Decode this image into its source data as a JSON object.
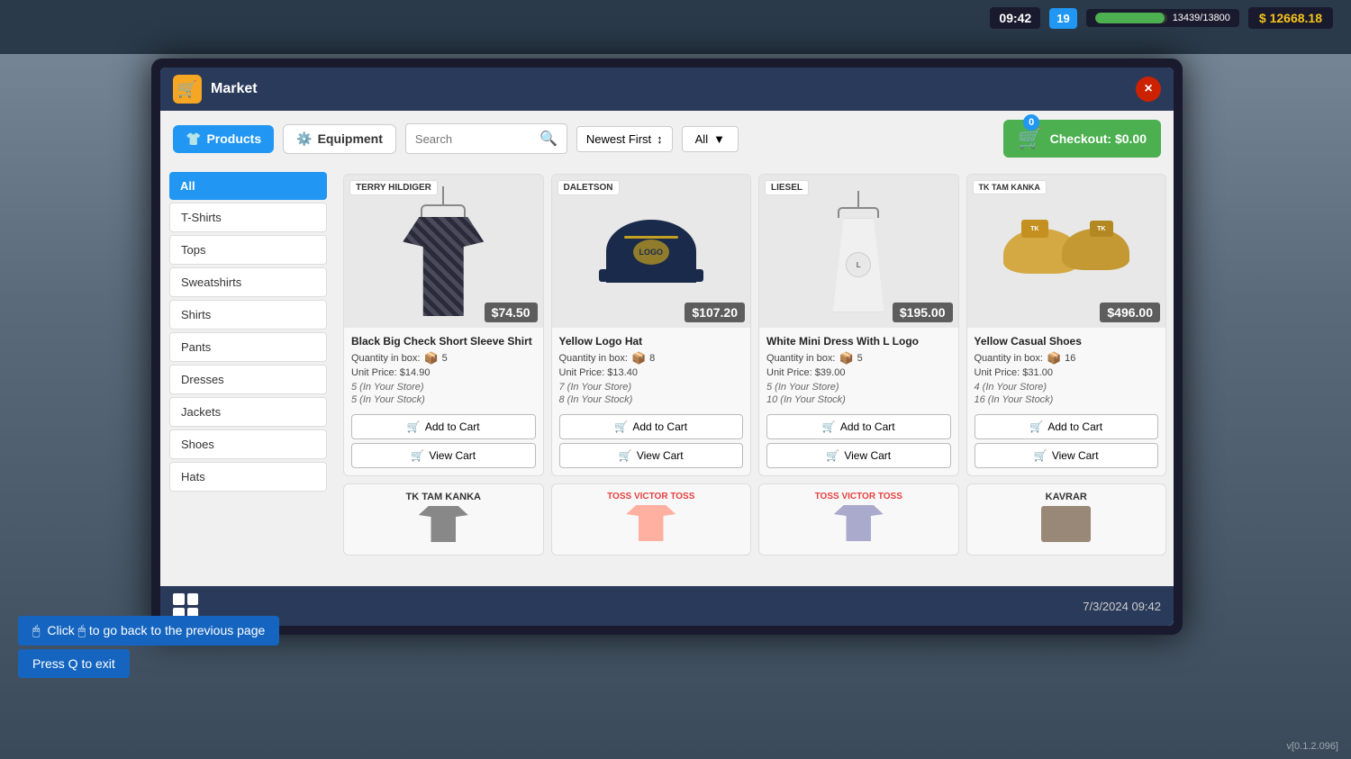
{
  "hud": {
    "time": "09:42",
    "level": "19",
    "xp_current": "13439",
    "xp_max": "13800",
    "xp_display": "13439/13800",
    "money": "$ 12668.18",
    "xp_percent": 97
  },
  "window": {
    "title": "Market",
    "close_label": "×"
  },
  "nav": {
    "products_tab": "Products",
    "equipment_tab": "Equipment",
    "search_placeholder": "Search",
    "sort_label": "Newest First",
    "filter_label": "All",
    "checkout_label": "Checkout: $0.00",
    "cart_count": "0"
  },
  "sidebar": {
    "items": [
      {
        "label": "All",
        "active": true
      },
      {
        "label": "T-Shirts",
        "active": false
      },
      {
        "label": "Tops",
        "active": false
      },
      {
        "label": "Sweatshirts",
        "active": false
      },
      {
        "label": "Shirts",
        "active": false
      },
      {
        "label": "Pants",
        "active": false
      },
      {
        "label": "Dresses",
        "active": false
      },
      {
        "label": "Jackets",
        "active": false
      },
      {
        "label": "Shoes",
        "active": false
      },
      {
        "label": "Hats",
        "active": false
      }
    ]
  },
  "products": [
    {
      "id": 1,
      "brand": "TERRY HILDIGER",
      "name": "Black Big Check Short Sleeve Shirt",
      "price": "$74.50",
      "qty_label": "Quantity in box:",
      "qty": "5",
      "unit_price": "Unit Price: $14.90",
      "store_qty": "5 (In Your Store)",
      "stock_qty": "5 (In Your Stock)",
      "type": "shirt"
    },
    {
      "id": 2,
      "brand": "DALETSON",
      "name": "Yellow Logo Hat",
      "price": "$107.20",
      "qty_label": "Quantity in box:",
      "qty": "8",
      "unit_price": "Unit Price: $13.40",
      "store_qty": "7 (In Your Store)",
      "stock_qty": "8 (In Your Stock)",
      "type": "hat"
    },
    {
      "id": 3,
      "brand": "LIESEL",
      "name": "White Mini Dress With L Logo",
      "price": "$195.00",
      "qty_label": "Quantity in box:",
      "qty": "5",
      "unit_price": "Unit Price: $39.00",
      "store_qty": "5 (In Your Store)",
      "stock_qty": "10 (In Your Stock)",
      "type": "dress"
    },
    {
      "id": 4,
      "brand": "TK TAM KANKA",
      "name": "Yellow Casual Shoes",
      "price": "$496.00",
      "qty_label": "Quantity in box:",
      "qty": "16",
      "unit_price": "Unit Price: $31.00",
      "store_qty": "4 (In Your Store)",
      "stock_qty": "16 (In Your Stock)",
      "type": "shoes"
    }
  ],
  "bottom_row_brands": [
    "TK TAM KANKA",
    "TOSS VICTOR TOSS",
    "TOSS VICTOR TOSS",
    "KAVRAR"
  ],
  "actions": {
    "add_to_cart": "Add to Cart",
    "view_cart": "View Cart"
  },
  "bottom_bar": {
    "datetime": "7/3/2024  09:42"
  },
  "hints": [
    "Click 🖱 to go back to the previous page",
    "Press Q to exit"
  ],
  "version": "v[0.1.2.096]"
}
